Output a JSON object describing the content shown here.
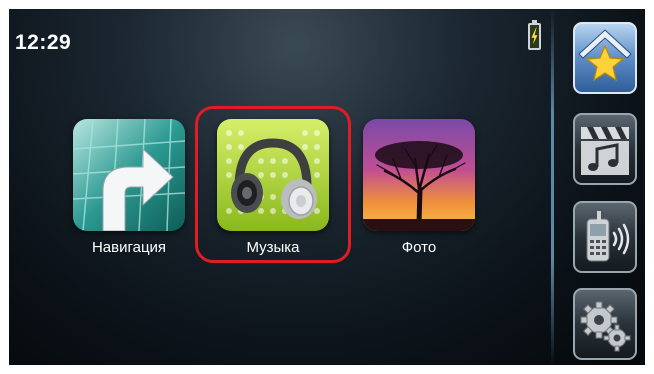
{
  "status": {
    "time": "12:29",
    "battery_icon": "battery-charging-icon"
  },
  "apps": [
    {
      "label": "Навигация",
      "icon": "navigation-arrow-icon"
    },
    {
      "label": "Музыка",
      "icon": "headphones-icon",
      "selected": true
    },
    {
      "label": "Фото",
      "icon": "tree-sunset-photo-icon"
    }
  ],
  "sidebar": {
    "buttons": [
      {
        "icon": "home-star-icon"
      },
      {
        "icon": "video-music-icon"
      },
      {
        "icon": "phone-icon"
      },
      {
        "icon": "settings-gears-icon"
      }
    ]
  },
  "colors": {
    "selection": "#e01c24",
    "background": "#0b1218"
  }
}
